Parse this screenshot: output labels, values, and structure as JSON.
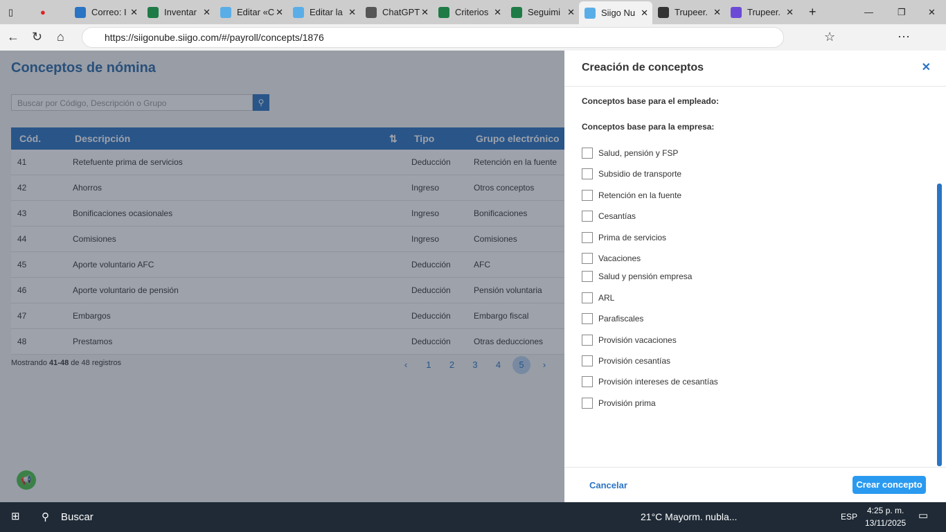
{
  "browser": {
    "tabs": [
      "Correo: I",
      "Inventar",
      "Editar «C",
      "Editar la",
      "ChatGPT",
      "Criterios",
      "Seguimi",
      "Siigo Nu",
      "Trupeer.",
      "Trupeer."
    ],
    "active_tab": 7,
    "url": "https://siigonube.siigo.com/#/payroll/concepts/1876"
  },
  "page": {
    "title": "Conceptos de nómina",
    "search_placeholder": "Buscar por Código, Descripción o Grupo",
    "columns": [
      "Cód.",
      "Descripción",
      "Tipo",
      "Grupo electrónico"
    ],
    "rows": [
      [
        "41",
        "Retefuente prima de servicios",
        "Deducción",
        "Retención en la fuente"
      ],
      [
        "42",
        "Ahorros",
        "Ingreso",
        "Otros conceptos"
      ],
      [
        "43",
        "Bonificaciones ocasionales",
        "Ingreso",
        "Bonificaciones"
      ],
      [
        "44",
        "Comisiones",
        "Ingreso",
        "Comisiones"
      ],
      [
        "45",
        "Aporte voluntario AFC",
        "Deducción",
        "AFC"
      ],
      [
        "46",
        "Aporte voluntario de pensión",
        "Deducción",
        "Pensión voluntaria"
      ],
      [
        "47",
        "Embargos",
        "Deducción",
        "Embargo fiscal"
      ],
      [
        "48",
        "Prestamos",
        "Deducción",
        "Otras deducciones"
      ]
    ],
    "footer": {
      "prefix": "Mostrando",
      "range": "41-48",
      "suffix": "de 48 registros"
    },
    "pages": [
      "1",
      "2",
      "3",
      "4",
      "5"
    ],
    "current_page": "5"
  },
  "panel": {
    "title": "Creación de conceptos",
    "employee_label": "Conceptos base para el empleado:",
    "company_label": "Conceptos base para la empresa:",
    "checkboxes": [
      "Salud, pensión y FSP",
      "Subsidio de transporte",
      "Retención en la fuente",
      "Cesantías",
      "Prima de servicios",
      "Vacaciones",
      "Salud y pensión empresa",
      "ARL",
      "Parafiscales",
      "Provisión vacaciones",
      "Provisión cesantías",
      "Provisión intereses de cesantías",
      "Provisión prima"
    ],
    "cancel": "Cancelar",
    "create": "Crear concepto"
  },
  "taskbar": {
    "search": "Buscar",
    "weather": "21°C  Mayorm. nubla...",
    "lang": "ESP",
    "time": "4:25 p. m.",
    "date": "13/11/2025"
  },
  "colors": {
    "accent": "#2a74c4",
    "button": "#2a9af0"
  }
}
